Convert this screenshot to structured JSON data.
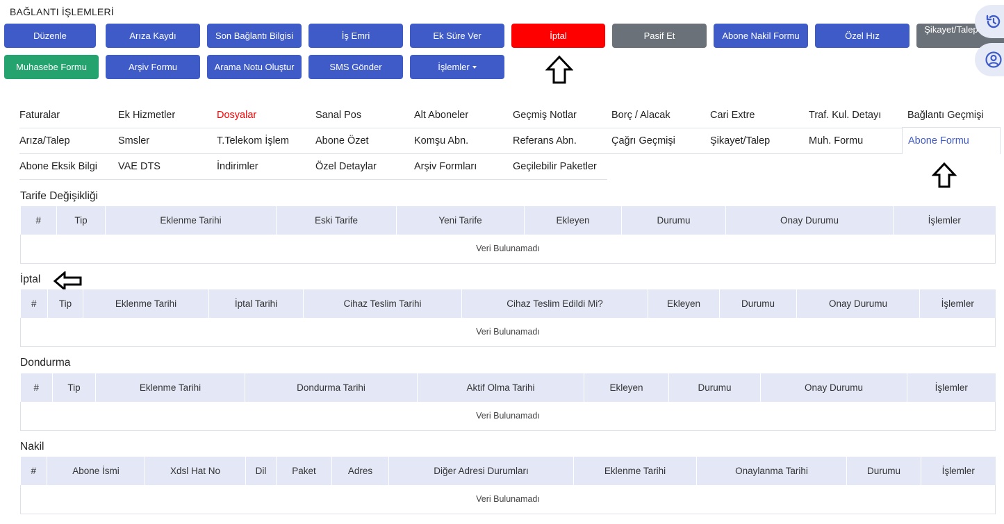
{
  "page_title": "BAĞLANTI İŞLEMLERİ",
  "colors": {
    "primary": "#3f5bc8",
    "danger": "#ff0000",
    "secondary": "#6b7178",
    "success": "#25a36f",
    "header_bg": "#e4e8f6"
  },
  "toolbar": {
    "row1": [
      "Düzenle",
      "Arıza Kaydı",
      "Son Bağlantı Bilgisi",
      "İş Emri",
      "Ek Süre Ver",
      "İptal",
      "Pasif Et",
      "Abone Nakil Formu",
      "Özel Hız",
      "Şikayet/Talep Öneri"
    ],
    "row2": [
      "Muhasebe Formu",
      "Arşiv Formu",
      "Arama Notu Oluştur",
      "SMS Gönder",
      "İşlemler"
    ]
  },
  "side_icons": [
    "history-icon",
    "user-circle-icon"
  ],
  "tabs": {
    "row1": [
      "Faturalar",
      "Ek Hizmetler",
      "Dosyalar",
      "Sanal Pos",
      "Alt Aboneler",
      "Geçmiş Notlar",
      "Borç / Alacak",
      "Cari Extre",
      "Traf. Kul. Detayı",
      "Bağlantı Geçmişi"
    ],
    "row2": [
      "Arıza/Talep",
      "Smsler",
      "T.Telekom İşlem",
      "Abone Özet",
      "Komşu Abn.",
      "Referans Abn.",
      "Çağrı Geçmişi",
      "Şikayet/Talep",
      "Muh. Formu",
      "Abone Formu"
    ],
    "row3": [
      "Abone Eksik Bilgi",
      "VAE DTS",
      "İndirimler",
      "Özel Detaylar",
      "Arşiv Formları",
      "Geçilebilir Paketler"
    ]
  },
  "sections": {
    "tarife": {
      "title": "Tarife Değişikliği",
      "columns": [
        "#",
        "Tip",
        "Eklenme Tarihi",
        "Eski Tarife",
        "Yeni Tarife",
        "Ekleyen",
        "Durumu",
        "Onay Durumu",
        "İşlemler"
      ],
      "empty": "Veri Bulunamadı"
    },
    "iptal": {
      "title": "İptal",
      "columns": [
        "#",
        "Tip",
        "Eklenme Tarihi",
        "İptal Tarihi",
        "Cihaz Teslim Tarihi",
        "Cihaz Teslim Edildi Mi?",
        "Ekleyen",
        "Durumu",
        "Onay Durumu",
        "İşlemler"
      ],
      "empty": "Veri Bulunamadı"
    },
    "dondurma": {
      "title": "Dondurma",
      "columns": [
        "#",
        "Tip",
        "Eklenme Tarihi",
        "Dondurma Tarihi",
        "Aktif Olma Tarihi",
        "Ekleyen",
        "Durumu",
        "Onay Durumu",
        "İşlemler"
      ],
      "empty": "Veri Bulunamadı"
    },
    "nakil": {
      "title": "Nakil",
      "columns": [
        "#",
        "Abone İsmi",
        "Xdsl Hat No",
        "Dil",
        "Paket",
        "Adres",
        "Diğer Adresi Durumları",
        "Eklenme Tarihi",
        "Onaylanma Tarihi",
        "Durumu",
        "İşlemler"
      ],
      "empty": "Veri Bulunamadı"
    }
  }
}
